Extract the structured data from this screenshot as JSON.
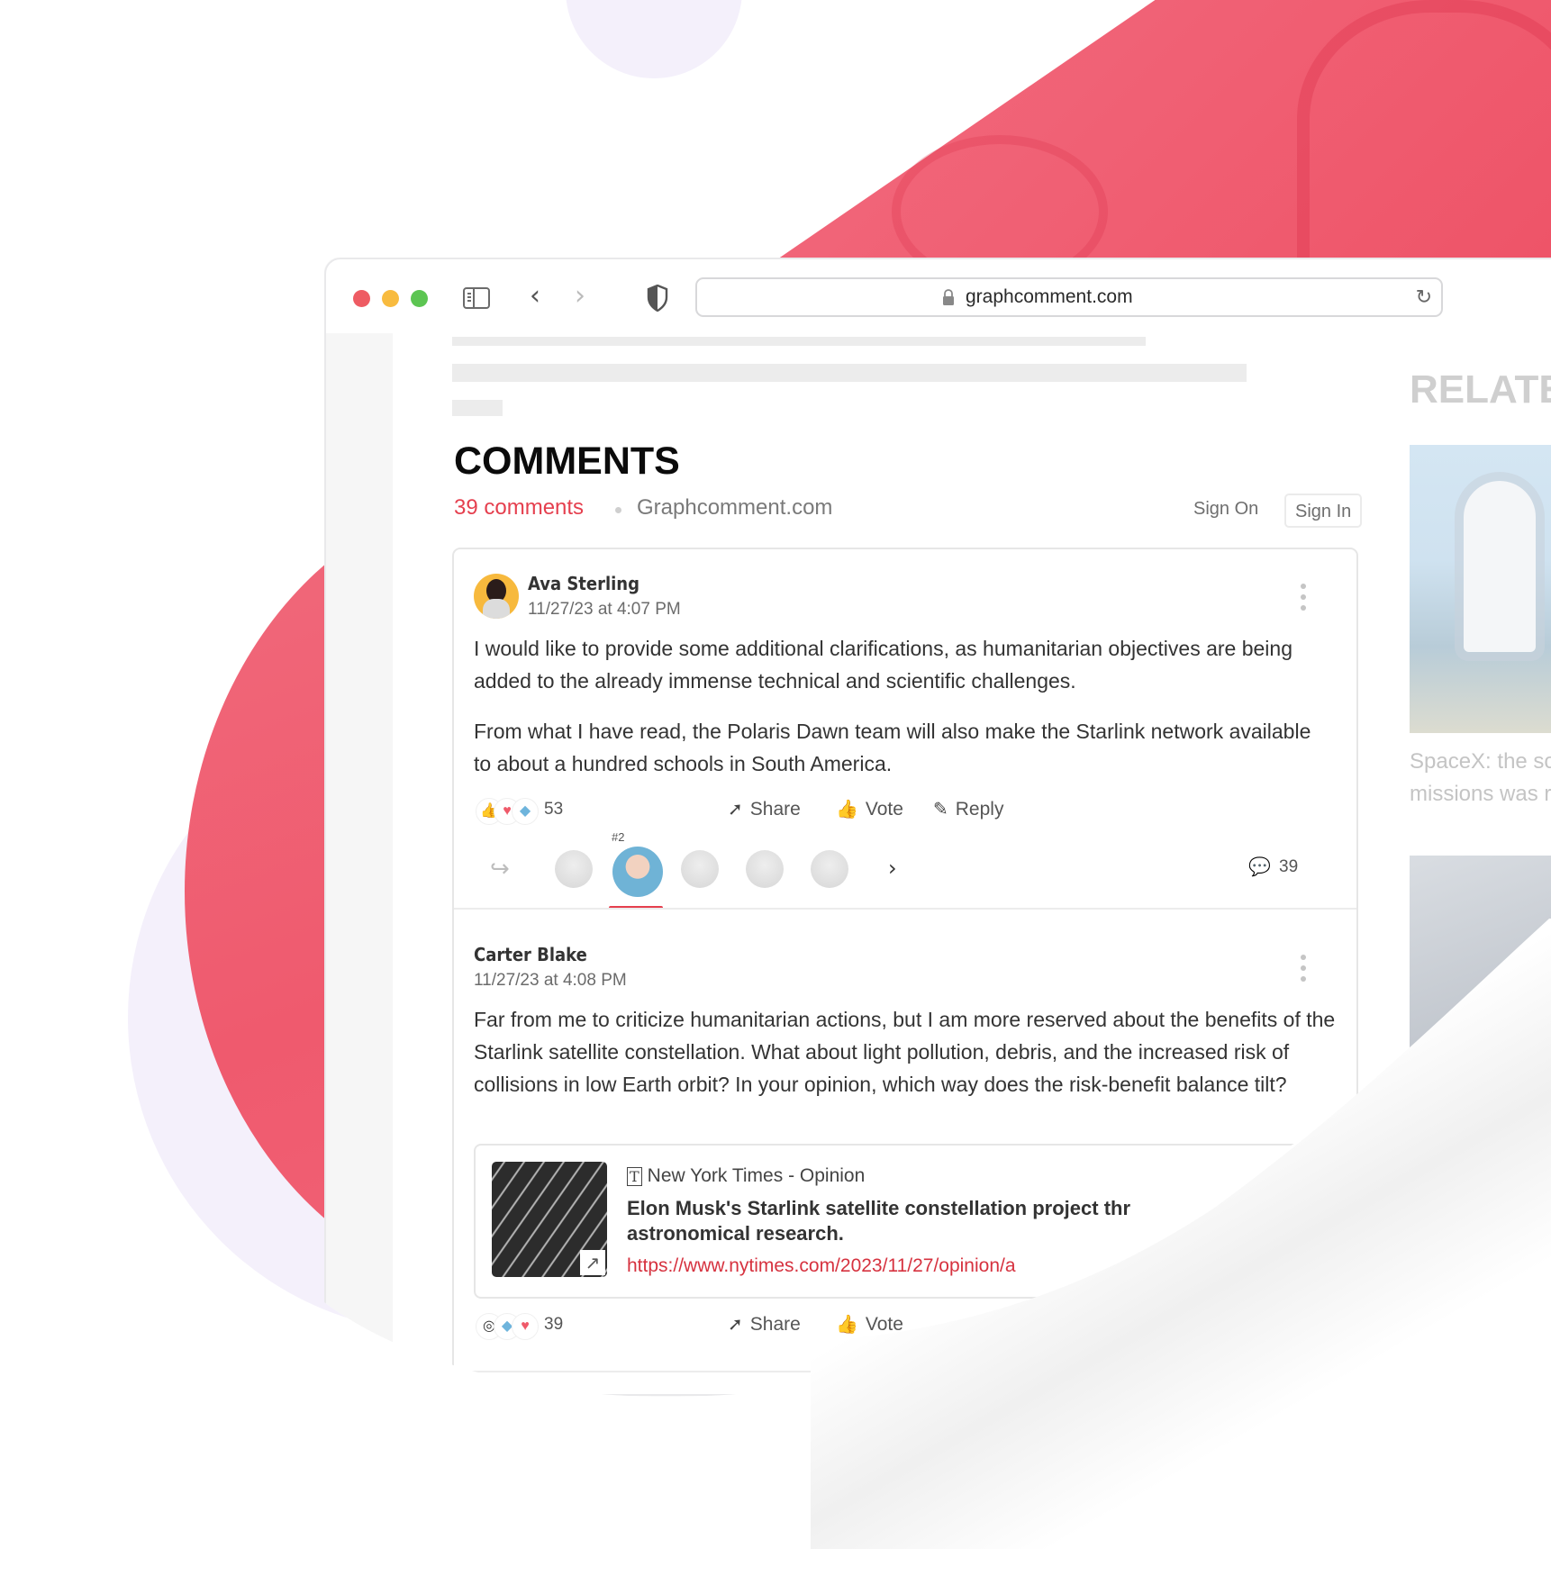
{
  "browser": {
    "url": "graphcomment.com",
    "traffic_lights": [
      "close",
      "minimize",
      "maximize"
    ]
  },
  "related": {
    "title": "RELATE",
    "card1_text_line1": "SpaceX: the so",
    "card1_text_line2": "missions was r"
  },
  "comments": {
    "title": "COMMENTS",
    "count_label": "39 comments",
    "site": "Graphcomment.com",
    "sign_on": "Sign On",
    "sign_in": "Sign In",
    "accent_color": "#e53f4e",
    "items": [
      {
        "author": "Ava Sterling",
        "timestamp": "11/27/23 at 4:07 PM",
        "paragraphs": [
          "I would like to provide some additional clarifications, as humanitarian objectives are being added to the already immense technical and scientific challenges.",
          "From what I have read, the Polaris Dawn team will also make the Starlink network available to about a hundred schools in South America."
        ],
        "reactions": [
          "thumbs-up",
          "heart",
          "diamond"
        ],
        "reaction_count": "53",
        "actions": {
          "share": "Share",
          "vote": "Vote",
          "reply": "Reply"
        },
        "voters": {
          "active_rank": "#2",
          "reply_count": "39"
        }
      },
      {
        "author": "Carter Blake",
        "timestamp": "11/27/23 at 4:08 PM",
        "paragraphs": [
          "Far from me to criticize humanitarian actions, but I am more reserved about the benefits of the Starlink satellite constellation. What about light pollution, debris, and the increased risk of collisions in low Earth orbit? In your opinion, which way does the risk-benefit balance tilt?"
        ],
        "link_preview": {
          "source": "New York Times - Opinion",
          "headline": "Elon Musk's Starlink satellite constellation project thr",
          "headline_line2": "astronomical research.",
          "url": "https://www.nytimes.com/2023/11/27/opinion/a"
        },
        "reactions": [
          "target",
          "diamond",
          "heart"
        ],
        "reaction_count": "39",
        "actions": {
          "share": "Share",
          "vote": "Vote"
        }
      }
    ]
  }
}
